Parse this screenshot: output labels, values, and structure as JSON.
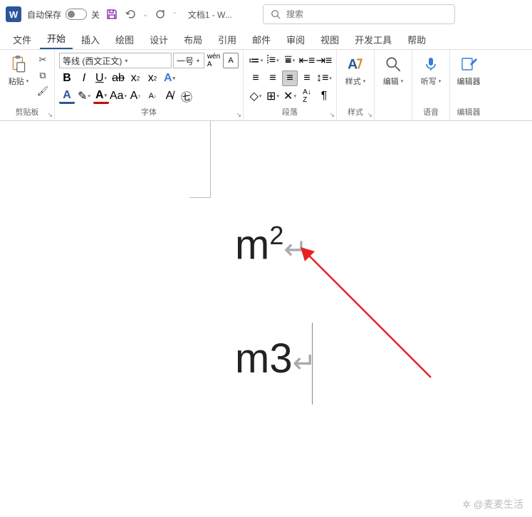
{
  "title_bar": {
    "autosave_label": "自动保存",
    "autosave_state": "关",
    "doc_title": "文档1  -  W...",
    "search_placeholder": "搜索"
  },
  "tabs": [
    "文件",
    "开始",
    "插入",
    "绘图",
    "设计",
    "布局",
    "引用",
    "邮件",
    "审阅",
    "视图",
    "开发工具",
    "帮助"
  ],
  "active_tab": "开始",
  "ribbon": {
    "clipboard": {
      "label": "剪贴板",
      "paste_label": "粘贴"
    },
    "font": {
      "label": "字体",
      "font_name": "等线 (西文正文)",
      "font_size": "一号"
    },
    "paragraph": {
      "label": "段落"
    },
    "styles": {
      "label": "样式",
      "big": "样式"
    },
    "editing": {
      "label": "",
      "big": "编辑"
    },
    "dictate": {
      "label": "语音",
      "big": "听写"
    },
    "editor": {
      "label": "编辑器",
      "big": "编辑器"
    }
  },
  "document": {
    "line1_base": "m",
    "line1_sup": "2",
    "line2_text": "m3"
  },
  "watermark": "✲ @麦麦生活"
}
